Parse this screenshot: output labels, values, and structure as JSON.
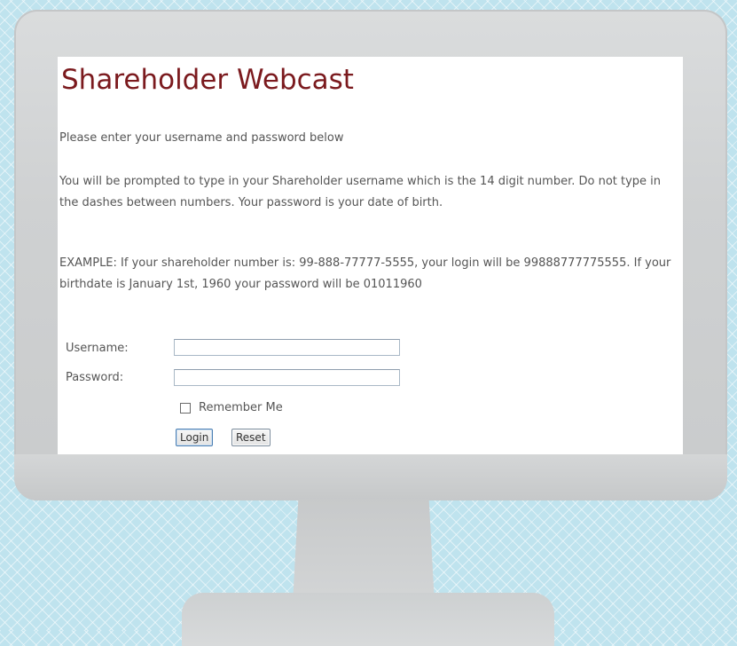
{
  "page": {
    "title": "Shareholder Webcast",
    "intro": "Please enter your username and password below",
    "instructions": "You will be prompted to type in your Shareholder username which is the 14 digit number. Do not type in the dashes between numbers. Your password is your date of birth.",
    "example": "EXAMPLE: If your shareholder number is: 99-888-77777-5555, your login will be 99888777775555. If your birthdate is January 1st, 1960 your password will be 01011960"
  },
  "form": {
    "username": {
      "label": "Username:",
      "value": ""
    },
    "password": {
      "label": "Password:",
      "value": ""
    },
    "remember": {
      "label": "Remember Me",
      "checked": false
    },
    "login_label": "Login",
    "reset_label": "Reset"
  },
  "colors": {
    "title": "#7b1a1e",
    "body_text": "#555555",
    "background": "#bfe3ee",
    "monitor": "#d0d2d3"
  }
}
